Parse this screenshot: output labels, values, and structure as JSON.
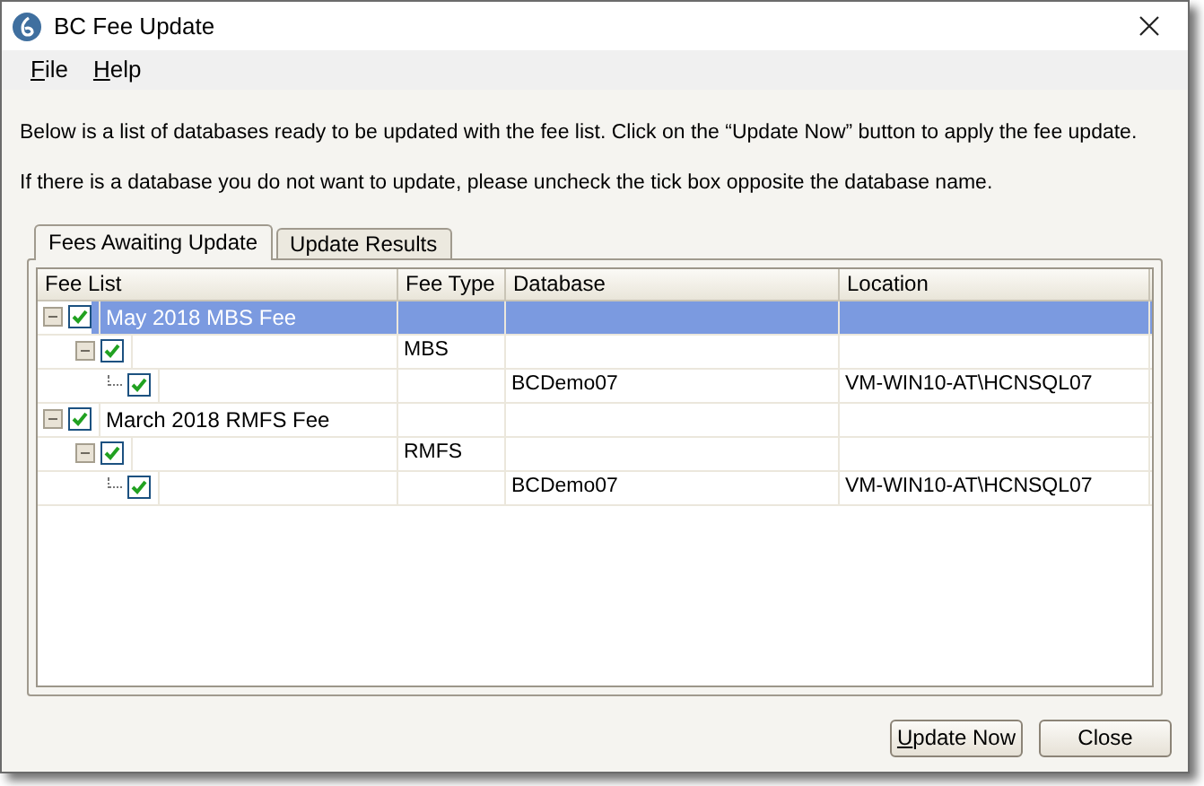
{
  "window": {
    "title": "BC Fee Update"
  },
  "menu": [
    {
      "label": "File"
    },
    {
      "label": "Help"
    }
  ],
  "instructions": [
    "Below is a list of databases ready to be updated with the fee list.  Click on the “Update Now” button to apply the fee update.",
    "If there is a database you do not want to update, please uncheck the tick box opposite the database name."
  ],
  "tabs": [
    {
      "label": "Fees Awaiting Update",
      "selected": true
    },
    {
      "label": "Update Results",
      "selected": false
    }
  ],
  "grid": {
    "columns": [
      "Fee List",
      "Fee Type",
      "Database",
      "Location"
    ],
    "rows": [
      {
        "fee_list": "May 2018 MBS Fee",
        "checked": true,
        "selected": true,
        "expanded": true,
        "children": [
          {
            "fee_type": "MBS",
            "checked": true,
            "selected": false,
            "expanded": true,
            "children": [
              {
                "database": "BCDemo07",
                "location": "VM-WIN10-AT\\HCNSQL07",
                "checked": true,
                "selected": false
              }
            ]
          }
        ]
      },
      {
        "fee_list": "March 2018 RMFS Fee",
        "checked": true,
        "selected": false,
        "expanded": true,
        "children": [
          {
            "fee_type": "RMFS",
            "checked": true,
            "selected": false,
            "expanded": true,
            "children": [
              {
                "database": "BCDemo07",
                "location": "VM-WIN10-AT\\HCNSQL07",
                "checked": true,
                "selected": false
              }
            ]
          }
        ]
      }
    ]
  },
  "buttons": [
    {
      "label": "Update Now"
    },
    {
      "label": "Close"
    }
  ]
}
